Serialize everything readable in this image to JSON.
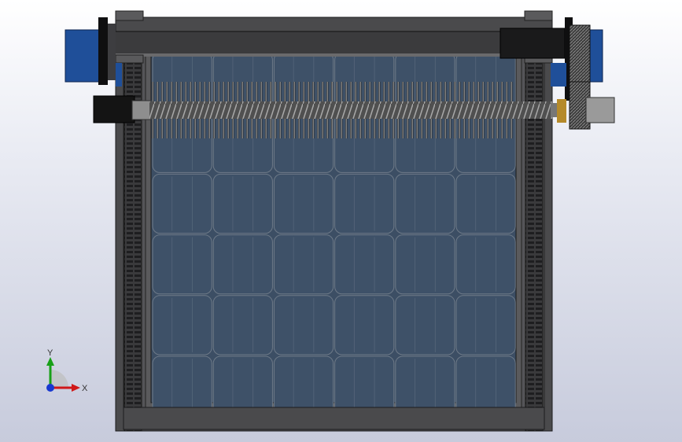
{
  "app": {
    "view": "front"
  },
  "colors": {
    "background_top": "#ffffff",
    "background_bottom": "#c7cbdc",
    "frame": "#4a4a4c",
    "frame_dark": "#2b2b2d",
    "panel": "#3e5168",
    "panel_line": "#6e7a88",
    "motor_blue": "#1f4f99",
    "gear": "#2d2d2d"
  },
  "triad": {
    "x_label": "X",
    "y_label": "Y",
    "x_color": "#d01818",
    "y_color": "#18a018",
    "z_color": "#1838d0"
  }
}
